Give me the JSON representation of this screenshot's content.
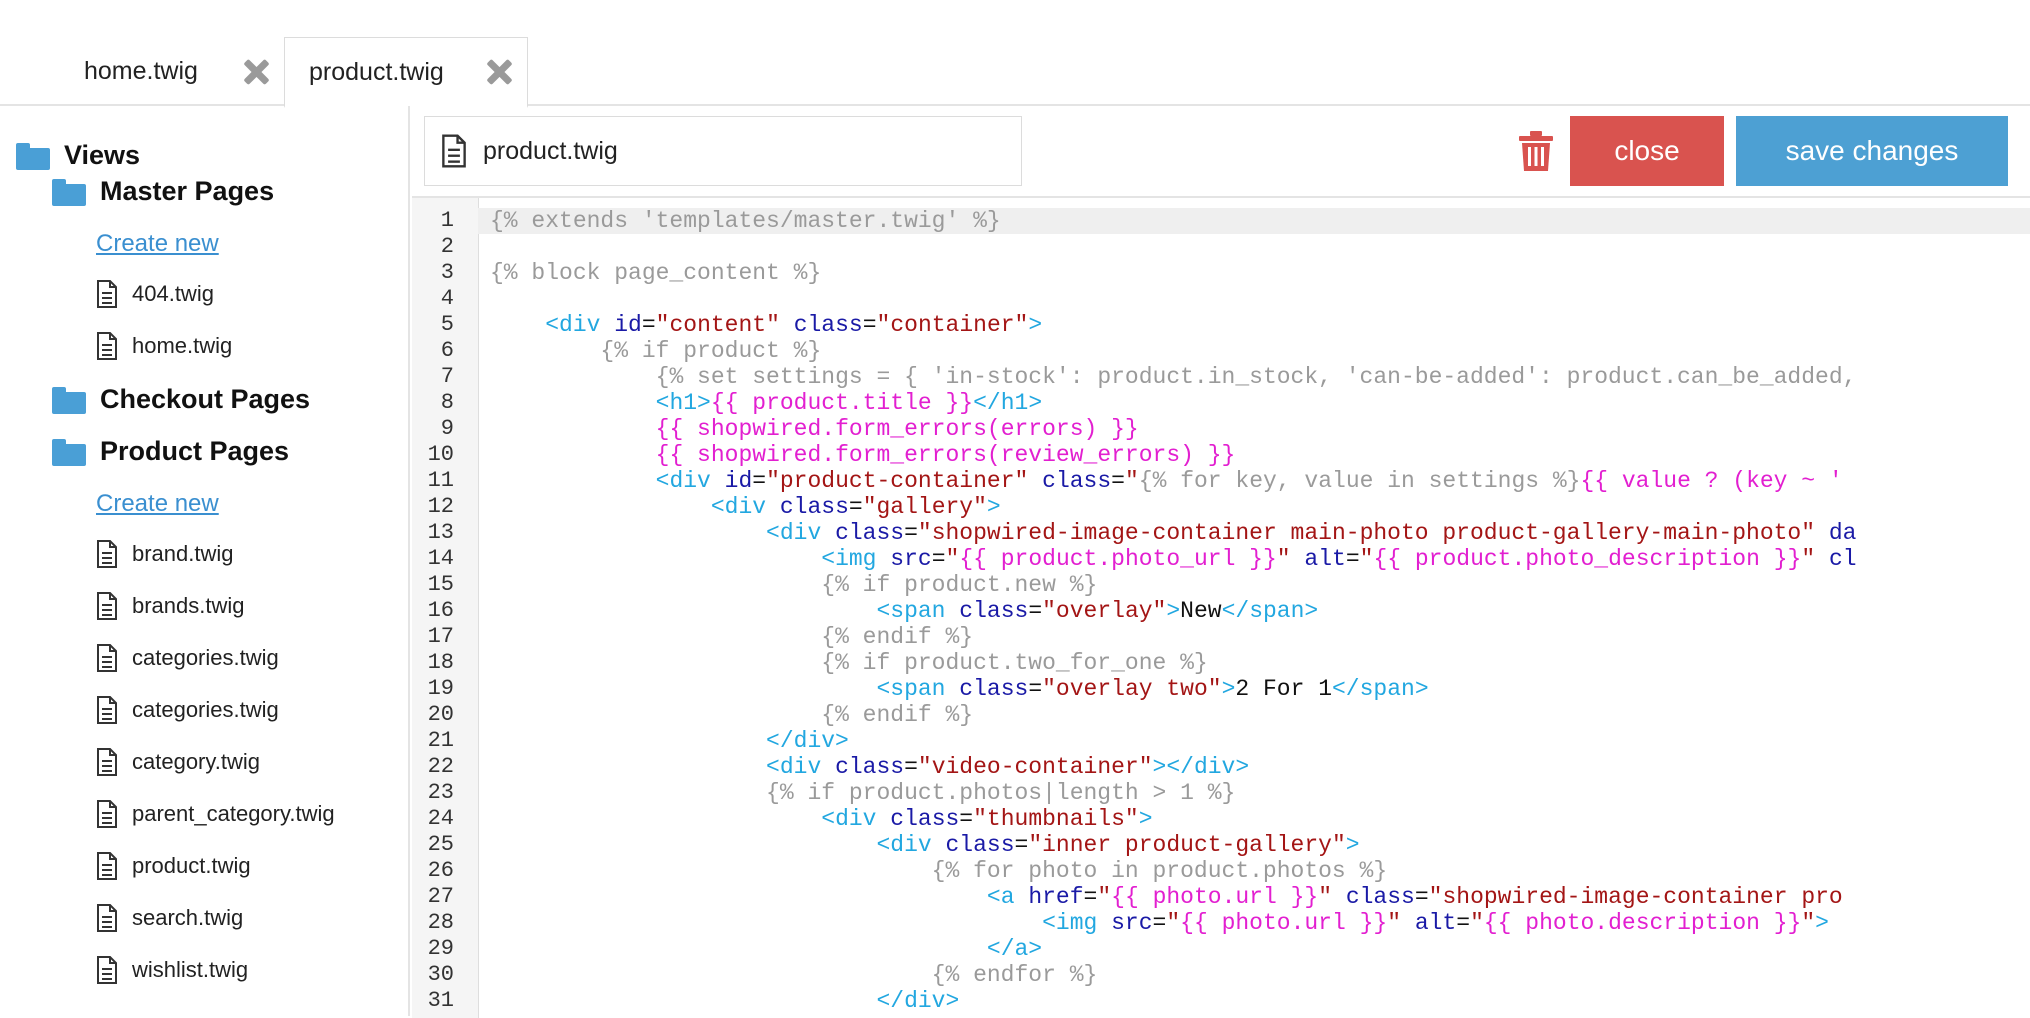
{
  "tabs": [
    {
      "label": "home.twig",
      "active": false
    },
    {
      "label": "product.twig",
      "active": true
    }
  ],
  "sidebar": {
    "root": "Views",
    "groups": [
      {
        "label": "Master Pages",
        "create": "Create new",
        "files": [
          "404.twig",
          "home.twig"
        ]
      },
      {
        "label": "Checkout Pages"
      },
      {
        "label": "Product Pages",
        "create": "Create new",
        "files": [
          "brand.twig",
          "brands.twig",
          "categories.twig",
          "categories.twig",
          "category.twig",
          "parent_category.twig",
          "product.twig",
          "search.twig",
          "wishlist.twig"
        ]
      }
    ]
  },
  "toolbar": {
    "filename": "product.twig",
    "close_label": "close",
    "save_label": "save changes"
  },
  "editor": {
    "line_numbers": [
      "1",
      "2",
      "3",
      "4",
      "5",
      "6",
      "7",
      "8",
      "9",
      "10",
      "11",
      "12",
      "13",
      "14",
      "15",
      "16",
      "17",
      "18",
      "19",
      "20",
      "21",
      "22",
      "23",
      "24",
      "25",
      "26",
      "27",
      "28",
      "29",
      "30",
      "31"
    ],
    "lines": [
      [
        [
          "tw",
          "{% extends 'templates/master.twig' %}"
        ]
      ],
      [],
      [
        [
          "tw",
          "{% block page_content %}"
        ]
      ],
      [],
      [
        [
          "sp",
          "    "
        ],
        [
          "tag",
          "<div "
        ],
        [
          "attr",
          "id"
        ],
        [
          "txt",
          "="
        ],
        [
          "str",
          "\"content\""
        ],
        [
          "txt",
          " "
        ],
        [
          "attr",
          "class"
        ],
        [
          "txt",
          "="
        ],
        [
          "str",
          "\"container\""
        ],
        [
          "tag",
          ">"
        ]
      ],
      [
        [
          "sp",
          "        "
        ],
        [
          "tw",
          "{% if product %}"
        ]
      ],
      [
        [
          "sp",
          "            "
        ],
        [
          "tw",
          "{% set settings = { 'in-stock': product.in_stock, 'can-be-added': product.can_be_added,"
        ]
      ],
      [
        [
          "sp",
          "            "
        ],
        [
          "tag",
          "<h1>"
        ],
        [
          "var",
          "{{ product.title }}"
        ],
        [
          "tag",
          "</h1>"
        ]
      ],
      [
        [
          "sp",
          "            "
        ],
        [
          "var",
          "{{ shopwired.form_errors(errors) }}"
        ]
      ],
      [
        [
          "sp",
          "            "
        ],
        [
          "var",
          "{{ shopwired.form_errors(review_errors) }}"
        ]
      ],
      [
        [
          "sp",
          "            "
        ],
        [
          "tag",
          "<div "
        ],
        [
          "attr",
          "id"
        ],
        [
          "txt",
          "="
        ],
        [
          "str",
          "\"product-container\""
        ],
        [
          "txt",
          " "
        ],
        [
          "attr",
          "class"
        ],
        [
          "txt",
          "="
        ],
        [
          "str",
          "\""
        ],
        [
          "tw",
          "{% for key, value in settings %}"
        ],
        [
          "var",
          "{{ value ? (key ~ '"
        ]
      ],
      [
        [
          "sp",
          "                "
        ],
        [
          "tag",
          "<div "
        ],
        [
          "attr",
          "class"
        ],
        [
          "txt",
          "="
        ],
        [
          "str",
          "\"gallery\""
        ],
        [
          "tag",
          ">"
        ]
      ],
      [
        [
          "sp",
          "                    "
        ],
        [
          "tag",
          "<div "
        ],
        [
          "attr",
          "class"
        ],
        [
          "txt",
          "="
        ],
        [
          "str",
          "\"shopwired-image-container main-photo product-gallery-main-photo\""
        ],
        [
          "txt",
          " "
        ],
        [
          "attr",
          "da"
        ]
      ],
      [
        [
          "sp",
          "                        "
        ],
        [
          "tag",
          "<img "
        ],
        [
          "attr",
          "src"
        ],
        [
          "txt",
          "="
        ],
        [
          "str",
          "\""
        ],
        [
          "var",
          "{{ product.photo_url }}"
        ],
        [
          "str",
          "\""
        ],
        [
          "txt",
          " "
        ],
        [
          "attr",
          "alt"
        ],
        [
          "txt",
          "="
        ],
        [
          "str",
          "\""
        ],
        [
          "var",
          "{{ product.photo_description }}"
        ],
        [
          "str",
          "\""
        ],
        [
          "txt",
          " "
        ],
        [
          "attr",
          "cl"
        ]
      ],
      [
        [
          "sp",
          "                        "
        ],
        [
          "tw",
          "{% if product.new %}"
        ]
      ],
      [
        [
          "sp",
          "                            "
        ],
        [
          "tag",
          "<span "
        ],
        [
          "attr",
          "class"
        ],
        [
          "txt",
          "="
        ],
        [
          "str",
          "\"overlay\""
        ],
        [
          "tag",
          ">"
        ],
        [
          "txt",
          "New"
        ],
        [
          "tag",
          "</span>"
        ]
      ],
      [
        [
          "sp",
          "                        "
        ],
        [
          "tw",
          "{% endif %}"
        ]
      ],
      [
        [
          "sp",
          "                        "
        ],
        [
          "tw",
          "{% if product.two_for_one %}"
        ]
      ],
      [
        [
          "sp",
          "                            "
        ],
        [
          "tag",
          "<span "
        ],
        [
          "attr",
          "class"
        ],
        [
          "txt",
          "="
        ],
        [
          "str",
          "\"overlay two\""
        ],
        [
          "tag",
          ">"
        ],
        [
          "txt",
          "2 For 1"
        ],
        [
          "tag",
          "</span>"
        ]
      ],
      [
        [
          "sp",
          "                        "
        ],
        [
          "tw",
          "{% endif %}"
        ]
      ],
      [
        [
          "sp",
          "                    "
        ],
        [
          "tag",
          "</div>"
        ]
      ],
      [
        [
          "sp",
          "                    "
        ],
        [
          "tag",
          "<div "
        ],
        [
          "attr",
          "class"
        ],
        [
          "txt",
          "="
        ],
        [
          "str",
          "\"video-container\""
        ],
        [
          "tag",
          "></div>"
        ]
      ],
      [
        [
          "sp",
          "                    "
        ],
        [
          "tw",
          "{% if product.photos|length > 1 %}"
        ]
      ],
      [
        [
          "sp",
          "                        "
        ],
        [
          "tag",
          "<div "
        ],
        [
          "attr",
          "class"
        ],
        [
          "txt",
          "="
        ],
        [
          "str",
          "\"thumbnails\""
        ],
        [
          "tag",
          ">"
        ]
      ],
      [
        [
          "sp",
          "                            "
        ],
        [
          "tag",
          "<div "
        ],
        [
          "attr",
          "class"
        ],
        [
          "txt",
          "="
        ],
        [
          "str",
          "\"inner product-gallery\""
        ],
        [
          "tag",
          ">"
        ]
      ],
      [
        [
          "sp",
          "                                "
        ],
        [
          "tw",
          "{% for photo in product.photos %}"
        ]
      ],
      [
        [
          "sp",
          "                                    "
        ],
        [
          "tag",
          "<a "
        ],
        [
          "attr",
          "href"
        ],
        [
          "txt",
          "="
        ],
        [
          "str",
          "\""
        ],
        [
          "var",
          "{{ photo.url }}"
        ],
        [
          "str",
          "\""
        ],
        [
          "txt",
          " "
        ],
        [
          "attr",
          "class"
        ],
        [
          "txt",
          "="
        ],
        [
          "str",
          "\"shopwired-image-container pro"
        ]
      ],
      [
        [
          "sp",
          "                                        "
        ],
        [
          "tag",
          "<img "
        ],
        [
          "attr",
          "src"
        ],
        [
          "txt",
          "="
        ],
        [
          "str",
          "\""
        ],
        [
          "var",
          "{{ photo.url }}"
        ],
        [
          "str",
          "\""
        ],
        [
          "txt",
          " "
        ],
        [
          "attr",
          "alt"
        ],
        [
          "txt",
          "="
        ],
        [
          "str",
          "\""
        ],
        [
          "var",
          "{{ photo.description }}"
        ],
        [
          "str",
          "\""
        ],
        [
          "tag",
          ">"
        ]
      ],
      [
        [
          "sp",
          "                                    "
        ],
        [
          "tag",
          "</a>"
        ]
      ],
      [
        [
          "sp",
          "                                "
        ],
        [
          "tw",
          "{% endfor %}"
        ]
      ],
      [
        [
          "sp",
          "                            "
        ],
        [
          "tag",
          "</div>"
        ]
      ]
    ]
  },
  "colors": {
    "close_button": "#d9534f",
    "save_button": "#4da0d3",
    "folder": "#4a9fd6",
    "link": "#3a8fd0",
    "trash": "#d9534f"
  }
}
